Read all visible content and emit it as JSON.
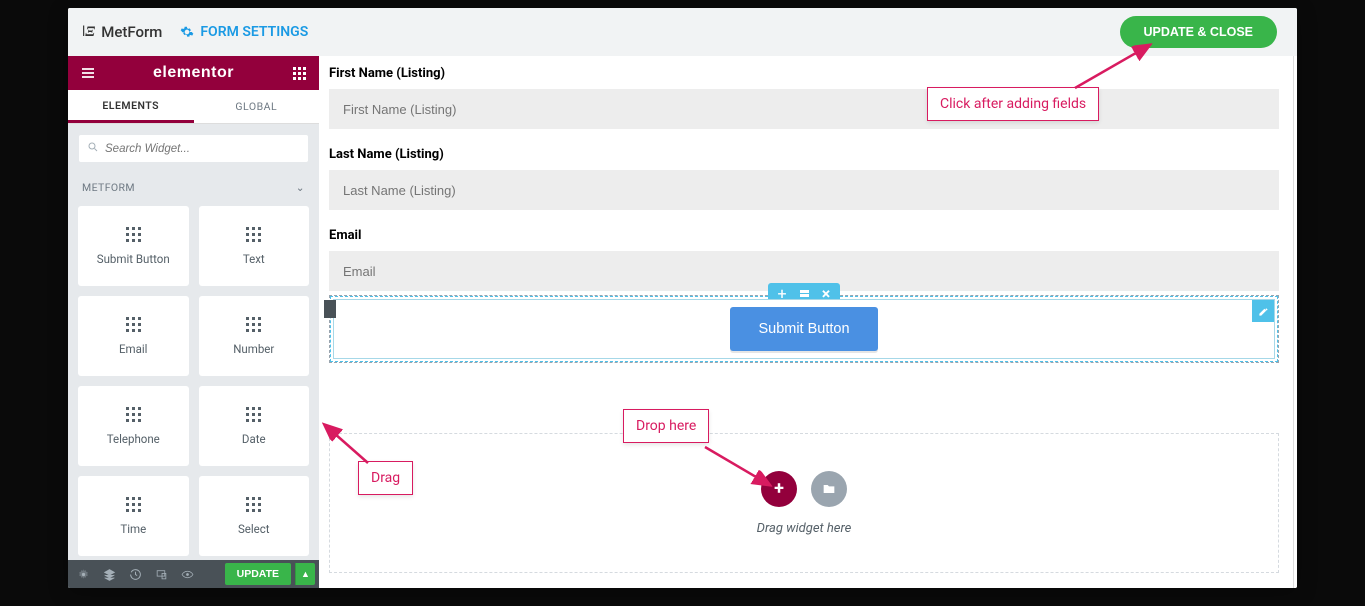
{
  "topbar": {
    "brand": "MetForm",
    "form_settings": "FORM SETTINGS",
    "update_close": "UPDATE & CLOSE"
  },
  "panel": {
    "brand": "elementor",
    "tabs": {
      "elements": "ELEMENTS",
      "global": "GLOBAL"
    },
    "search_placeholder": "Search Widget...",
    "category": "METFORM",
    "widgets": [
      "Submit Button",
      "Text",
      "Email",
      "Number",
      "Telephone",
      "Date",
      "Time",
      "Select"
    ],
    "footer_update": "UPDATE"
  },
  "canvas": {
    "fields": [
      {
        "label": "First Name (Listing)",
        "placeholder": "First Name (Listing)"
      },
      {
        "label": "Last Name (Listing)",
        "placeholder": "Last Name (Listing)"
      },
      {
        "label": "Email",
        "placeholder": "Email"
      }
    ],
    "submit_button": "Submit Button",
    "dropzone_text": "Drag widget here"
  },
  "callouts": {
    "click_after": "Click after adding fields",
    "drop_here": "Drop here",
    "drag": "Drag"
  }
}
